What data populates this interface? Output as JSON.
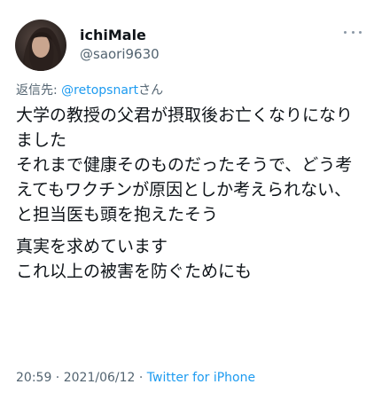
{
  "author": {
    "display_name": "ichiMale",
    "handle": "@saori9630",
    "avatar_icon": "profile-photo"
  },
  "reply": {
    "prefix": "返信先: ",
    "mention": "@retopsnart",
    "suffix": "さん"
  },
  "tweet": {
    "paragraphs": [
      "大学の教授の父君が摂取後お亡くなりになりました\nそれまで健康そのものだったそうで、どう考えてもワクチンが原因としか考えられない、と担当医も頭を抱えたそう",
      "真実を求めています\nこれ以上の被害を防ぐためにも"
    ]
  },
  "meta": {
    "time": "20:59",
    "sep1": " · ",
    "date": "2021/06/12",
    "sep2": " · ",
    "source": "Twitter for iPhone"
  },
  "colors": {
    "link": "#1d9bf0",
    "secondary_text": "#536471",
    "primary_text": "#0f1419"
  },
  "icons": {
    "more": "more-horizontal-icon"
  }
}
